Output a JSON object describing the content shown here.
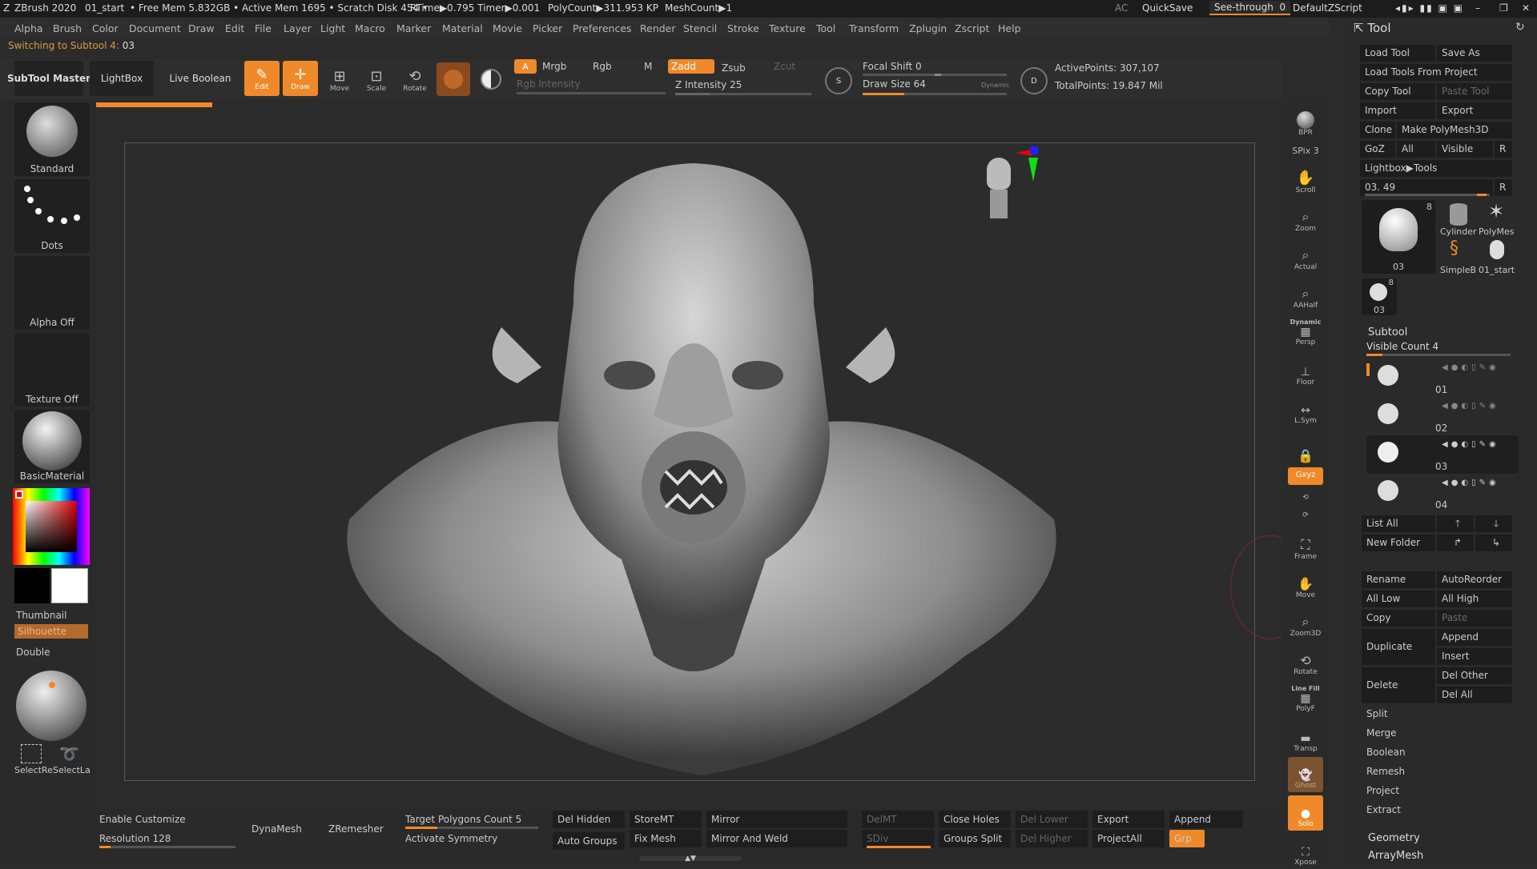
{
  "title": {
    "app": "ZBrush 2020",
    "file": "01_start",
    "stats": "• Free Mem 5.832GB • Active Mem 1695 • Scratch Disk 454 •",
    "rtime": "RTime▶0.795 Timer▶0.001",
    "polycount": "PolyCount▶311.953 KP",
    "meshcount": "MeshCount▶1",
    "ac": "AC",
    "quicksave": "QuickSave",
    "seethrough": "See-through",
    "seethrough_value": "0",
    "script": "DefaultZScript"
  },
  "menu": [
    "Alpha",
    "Brush",
    "Color",
    "Document",
    "Draw",
    "Edit",
    "File",
    "Layer",
    "Light",
    "Macro",
    "Marker",
    "Material",
    "Movie",
    "Picker",
    "Preferences",
    "Render",
    "Stencil",
    "Stroke",
    "Texture",
    "Tool",
    "Transform",
    "Zplugin",
    "Zscript",
    "Help"
  ],
  "status": {
    "text": "Switching to Subtool 4:",
    "value": "03"
  },
  "topbar": {
    "subtool_master": "SubTool Master",
    "lightbox": "LightBox",
    "live_boolean": "Live Boolean",
    "edit": "Edit",
    "draw": "Draw",
    "move": "Move",
    "scale": "Scale",
    "rotate": "Rotate",
    "a": "A",
    "mrgb": "Mrgb",
    "rgb": "Rgb",
    "m": "M",
    "zadd": "Zadd",
    "zsub": "Zsub",
    "zcut": "Zcut",
    "rgb_intensity": "Rgb Intensity",
    "z_intensity": "Z Intensity 25",
    "z_intensity_value": 25,
    "focal_shift": "Focal Shift 0",
    "draw_size": "Draw Size 64",
    "draw_size_value": 64,
    "dynamic": "Dynamic",
    "active_points": "ActivePoints: 307,107",
    "total_points": "TotalPoints: 19.847 Mil"
  },
  "left": {
    "brush": "Standard",
    "stroke": "Dots",
    "alpha": "Alpha Off",
    "texture": "Texture Off",
    "material": "BasicMaterial",
    "thumbnail": "Thumbnail",
    "silhouette": "Silhouette",
    "double": "Double",
    "select_rect": "SelectRe",
    "select_lasso": "SelectLa"
  },
  "shelf": [
    "BPR",
    "SPix 3",
    "Scroll",
    "Zoom",
    "Actual",
    "AAHalf",
    "Persp",
    "Floor",
    "L.Sym",
    "",
    "Gxyz",
    "",
    "",
    "Frame",
    "Move",
    "Zoom3D",
    "Rotate",
    "PolyF",
    "Transp",
    "Ghost",
    "Solo",
    "Xpose"
  ],
  "shelf_extra": {
    "dynamic": "Dynamic",
    "linefill": "Line Fill"
  },
  "tool": {
    "header": "Tool",
    "load_tool": "Load Tool",
    "save_as": "Save As",
    "load_from_project": "Load Tools From Project",
    "copy_tool": "Copy Tool",
    "paste_tool": "Paste Tool",
    "import": "Import",
    "export": "Export",
    "clone": "Clone",
    "make_polymesh": "Make PolyMesh3D",
    "goz": "GoZ",
    "all": "All",
    "visible": "Visible",
    "r": "R",
    "lightbox_tools": "Lightbox▶Tools",
    "current": "03. 49",
    "thumbs": [
      {
        "label": "03",
        "badge": "8"
      },
      {
        "label": "Cylinder"
      },
      {
        "label": "PolyMes"
      },
      {
        "label": "SimpleB"
      },
      {
        "label": "01_start"
      },
      {
        "label": "03",
        "badge": "8"
      }
    ]
  },
  "subtool": {
    "header": "Subtool",
    "visible_count": "Visible Count 4",
    "items": [
      {
        "label": "01"
      },
      {
        "label": "02"
      },
      {
        "label": "03"
      },
      {
        "label": "04"
      }
    ],
    "list_all": "List All",
    "new_folder": "New Folder",
    "rename": "Rename",
    "autoreorder": "AutoReorder",
    "all_low": "All Low",
    "all_high": "All High",
    "copy": "Copy",
    "paste": "Paste",
    "duplicate": "Duplicate",
    "append": "Append",
    "insert": "Insert",
    "delete": "Delete",
    "del_other": "Del Other",
    "del_all": "Del All",
    "split": "Split",
    "merge": "Merge",
    "boolean": "Boolean",
    "remesh": "Remesh",
    "project": "Project",
    "extract": "Extract",
    "geometry": "Geometry",
    "arraymesh": "ArrayMesh"
  },
  "bottom": {
    "enable_customize": "Enable Customize",
    "resolution": "Resolution 128",
    "dynamesh": "DynaMesh",
    "zremesher": "ZRemesher",
    "target_polys": "Target Polygons Count 5",
    "activate_symmetry": "Activate Symmetry",
    "del_hidden": "Del Hidden",
    "auto_groups": "Auto Groups",
    "storemt": "StoreMT",
    "fix_mesh": "Fix Mesh",
    "mirror": "Mirror",
    "mirror_weld": "Mirror And Weld",
    "delmt": "DelMT",
    "sdiv": "SDiv",
    "close_holes": "Close Holes",
    "groups_split": "Groups Split",
    "del_lower": "Del Lower",
    "del_higher": "Del Higher",
    "export": "Export",
    "projectall": "ProjectAll",
    "append": "Append",
    "grp": "Grp"
  },
  "colors": {
    "accent": "#f0892a",
    "bg": "#2b2b2b"
  }
}
